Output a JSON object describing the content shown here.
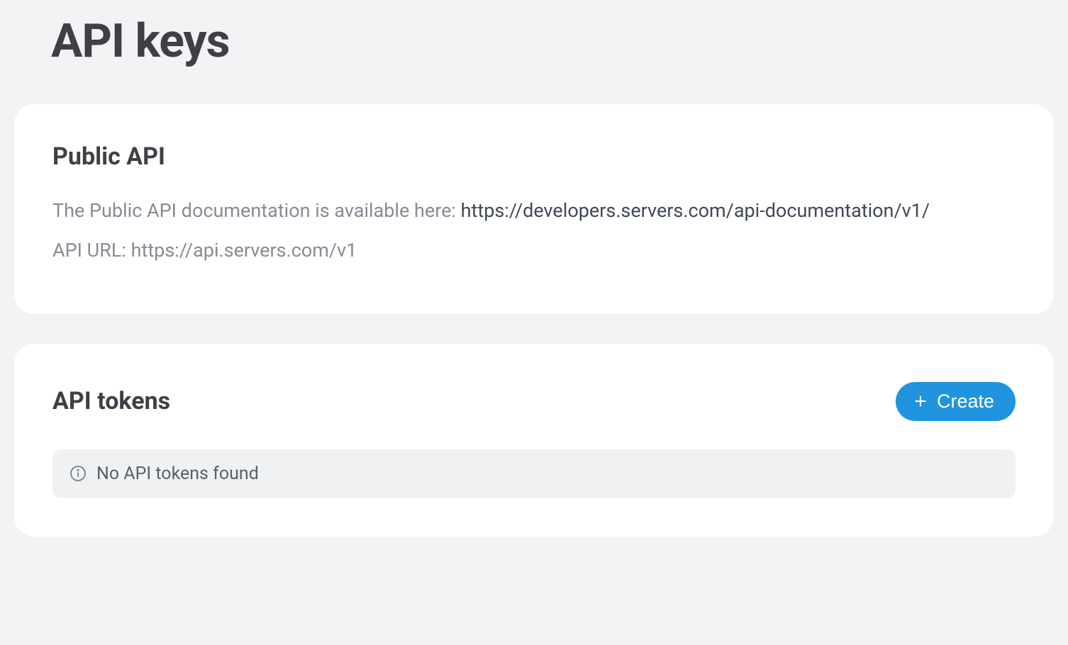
{
  "page": {
    "title": "API keys"
  },
  "public_api": {
    "heading": "Public API",
    "description_prefix": "The Public API documentation is available here: ",
    "documentation_url": "https://developers.servers.com/api-documentation/v1/",
    "api_url_label": "API URL: ",
    "api_url_value": "https://api.servers.com/v1"
  },
  "api_tokens": {
    "heading": "API tokens",
    "create_button_label": "Create",
    "empty_message": "No API tokens found"
  }
}
